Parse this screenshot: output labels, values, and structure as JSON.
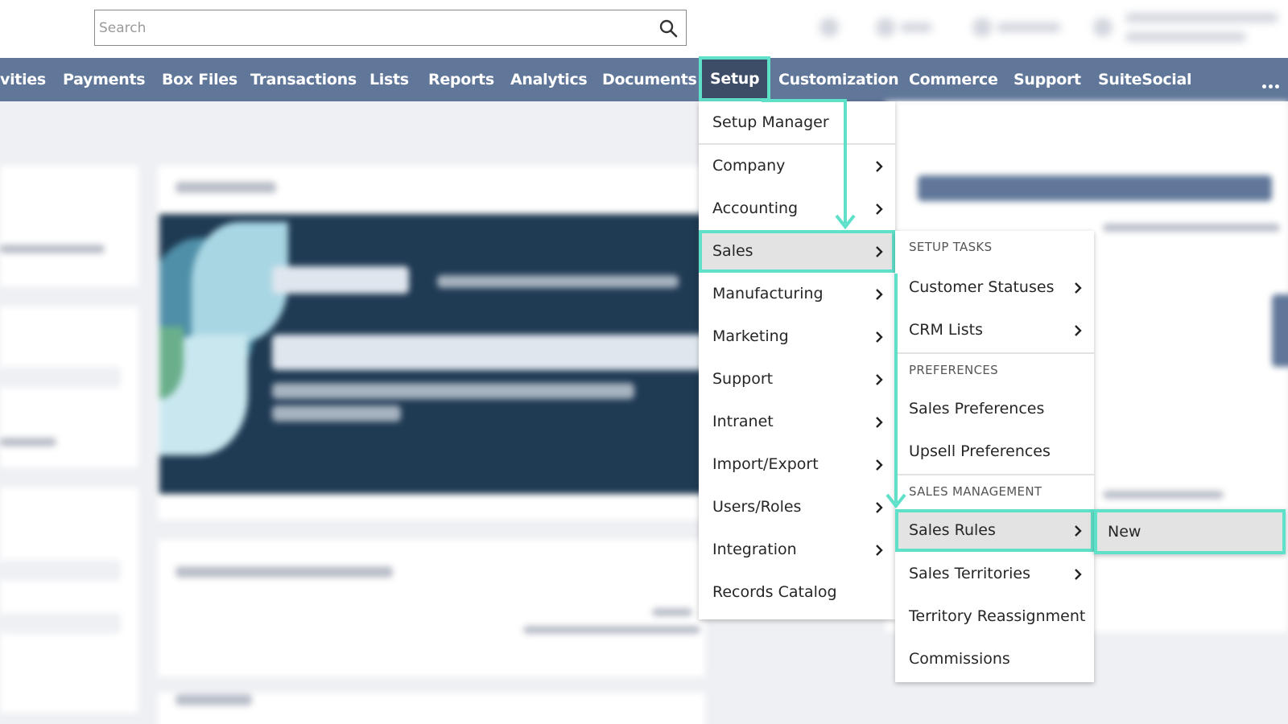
{
  "search": {
    "placeholder": "Search"
  },
  "nav": {
    "items": [
      "vities",
      "Payments",
      "Box Files",
      "Transactions",
      "Lists",
      "Reports",
      "Analytics",
      "Documents",
      "Setup",
      "Customization",
      "Commerce",
      "Support",
      "SuiteSocial"
    ],
    "active": "Setup"
  },
  "setup_menu": {
    "items": [
      {
        "label": "Setup Manager"
      },
      {
        "label": "Company"
      },
      {
        "label": "Accounting"
      },
      {
        "label": "Sales"
      },
      {
        "label": "Manufacturing"
      },
      {
        "label": "Marketing"
      },
      {
        "label": "Support"
      },
      {
        "label": "Intranet"
      },
      {
        "label": "Import/Export"
      },
      {
        "label": "Users/Roles"
      },
      {
        "label": "Integration"
      },
      {
        "label": "Records Catalog"
      }
    ]
  },
  "sales_menu": {
    "setup_tasks_header": "SETUP TASKS",
    "customer_statuses": "Customer Statuses",
    "crm_lists": "CRM Lists",
    "preferences_header": "PREFERENCES",
    "sales_preferences": "Sales Preferences",
    "upsell_preferences": "Upsell Preferences",
    "sales_management_header": "SALES MANAGEMENT",
    "sales_rules": "Sales Rules",
    "sales_territories": "Sales Territories",
    "territory_reassignment": "Territory Reassignment",
    "commissions": "Commissions"
  },
  "sales_rules_menu": {
    "new": "New"
  },
  "colors": {
    "nav_bg": "#607799",
    "nav_active_bg": "#3d4d67",
    "highlight": "#5fe0c9",
    "menu_hover": "#e3e3e3"
  },
  "icons": [
    "search-icon",
    "chevron-right-icon",
    "more-icon"
  ]
}
